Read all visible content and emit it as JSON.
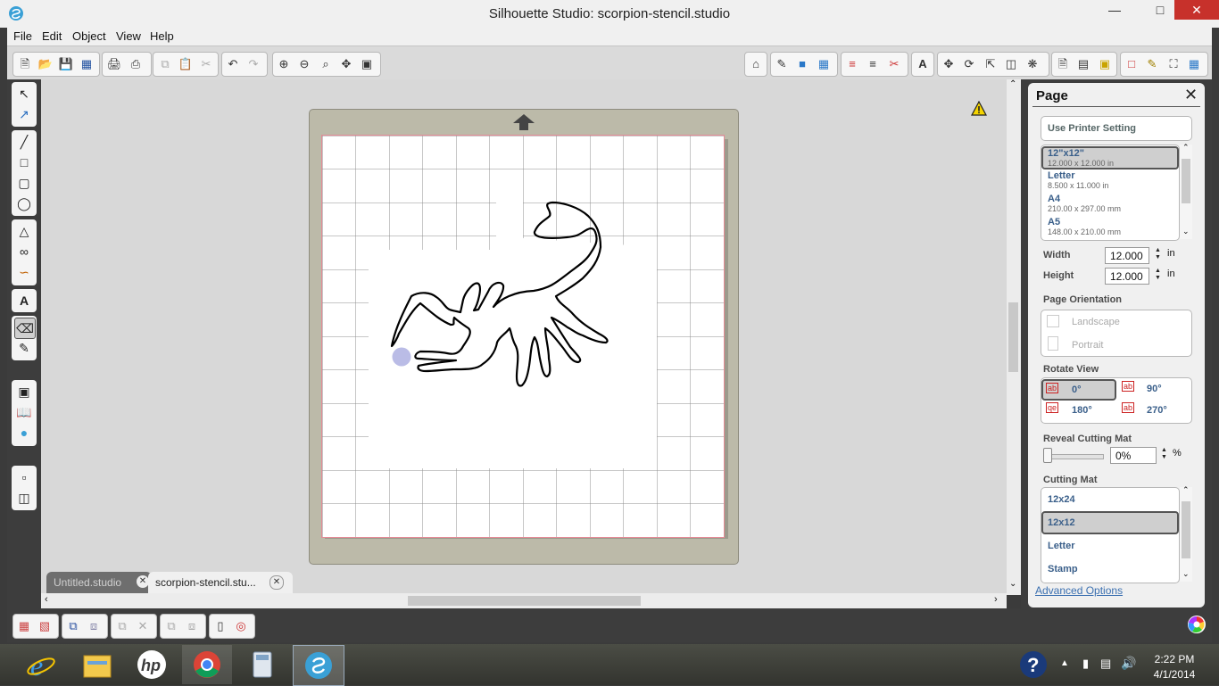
{
  "window": {
    "title": "Silhouette Studio: scorpion-stencil.studio",
    "minimize": "—",
    "maximize": "□",
    "close": "✕"
  },
  "menu": [
    "File",
    "Edit",
    "Object",
    "View",
    "Help"
  ],
  "toolbar_icons": {
    "left": [
      "new-icon",
      "open-icon",
      "save-icon",
      "save-to-sd-icon",
      "print-icon",
      "print-cut-icon",
      "copy-icon",
      "paste-icon",
      "cut-icon",
      "undo-icon",
      "redo-icon",
      "zoom-in-icon",
      "zoom-out-icon",
      "zoom-select-icon",
      "zoom-pan-icon",
      "fit-page-icon"
    ],
    "right": [
      "store-icon",
      "fill-icon",
      "fill-gradient-icon",
      "fill-pattern-icon",
      "line-color-icon",
      "line-style-icon",
      "cut-style-icon",
      "text-style-icon",
      "transform-icon",
      "rotate-icon",
      "scale-icon",
      "align-icon",
      "replicate-icon",
      "page-settings-icon",
      "cut-settings-icon",
      "trace-icon",
      "registration-icon",
      "sketch-icon",
      "knife-icon",
      "grid-icon"
    ]
  },
  "doc_tabs": [
    {
      "label": "Untitled.studio",
      "active": false
    },
    {
      "label": "scorpion-stencil.stu...",
      "active": true
    }
  ],
  "page_panel": {
    "title": "Page",
    "printer_setting": "Use Printer Setting",
    "page_sizes": [
      {
        "name": "12\"x12\"",
        "dims": "12.000 x 12.000 in",
        "selected": true
      },
      {
        "name": "Letter",
        "dims": "8.500 x 11.000 in",
        "selected": false
      },
      {
        "name": "A4",
        "dims": "210.00 x 297.00 mm",
        "selected": false
      },
      {
        "name": "A5",
        "dims": "148.00 x 210.00 mm",
        "selected": false
      }
    ],
    "width_label": "Width",
    "width_value": "12.000",
    "height_label": "Height",
    "height_value": "12.000",
    "unit": "in",
    "orientation_label": "Page Orientation",
    "landscape": "Landscape",
    "portrait": "Portrait",
    "rotate_label": "Rotate View",
    "rot_0": "0°",
    "rot_90": "90°",
    "rot_180": "180°",
    "rot_270": "270°",
    "reveal_label": "Reveal Cutting Mat",
    "reveal_value": "0%",
    "percent": "%",
    "reveal_fraction": 0,
    "mat_label": "Cutting Mat",
    "mats": [
      {
        "name": "12x24",
        "selected": false
      },
      {
        "name": "12x12",
        "selected": true
      },
      {
        "name": "Letter",
        "selected": false
      },
      {
        "name": "Stamp",
        "selected": false
      }
    ],
    "advanced": "Advanced Options"
  },
  "taskbar": {
    "apps": [
      "ie-icon",
      "file-explorer-icon",
      "hp-icon",
      "chrome-icon",
      "calculator-icon",
      "silhouette-icon"
    ],
    "time": "2:22 PM",
    "date": "4/1/2014"
  }
}
